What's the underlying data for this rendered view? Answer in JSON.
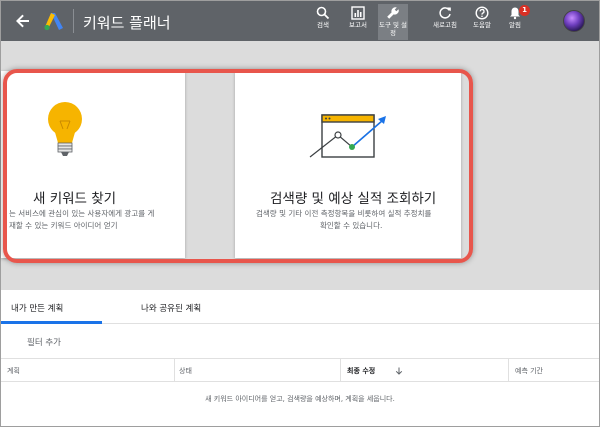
{
  "header": {
    "title": "키워드 플래너",
    "tools": [
      {
        "id": "search",
        "label": "검색"
      },
      {
        "id": "report",
        "label": "보고서"
      },
      {
        "id": "tools",
        "label": "도구 및 설정"
      },
      {
        "id": "refresh",
        "label": "새로고침"
      },
      {
        "id": "help",
        "label": "도움말"
      },
      {
        "id": "notifications",
        "label": "알림"
      }
    ],
    "notification_count": "1"
  },
  "cards": [
    {
      "title": "새 키워드 찾기",
      "desc_line1": "는 서비스에 관심이 있는 사용자에게 광고를 게",
      "desc_line2": "재할 수 있는 키워드 아이디어 얻기"
    },
    {
      "title": "검색량 및 예상 실적 조회하기",
      "desc_line1": "검색량 및 기타 이전 측정항목을 비롯하여 실적 추정치를",
      "desc_line2": "확인할 수 있습니다."
    }
  ],
  "plans": {
    "tabs": [
      {
        "label": "내가 만든 계획",
        "selected": true
      },
      {
        "label": "나와 공유된 계획",
        "selected": false
      }
    ],
    "filter_label": "필터 추가",
    "columns": [
      "계획",
      "상태",
      "최종 수정",
      "예측 기간"
    ],
    "empty_message": "새 키워드 아이디어를 얻고, 검색량을 예상하며, 계획을 세웁니다."
  },
  "colors": {
    "topbar": "#5f6368",
    "accent_blue": "#1a73e8",
    "highlight_red": "#e8564c",
    "bulb_yellow": "#f6b400"
  }
}
